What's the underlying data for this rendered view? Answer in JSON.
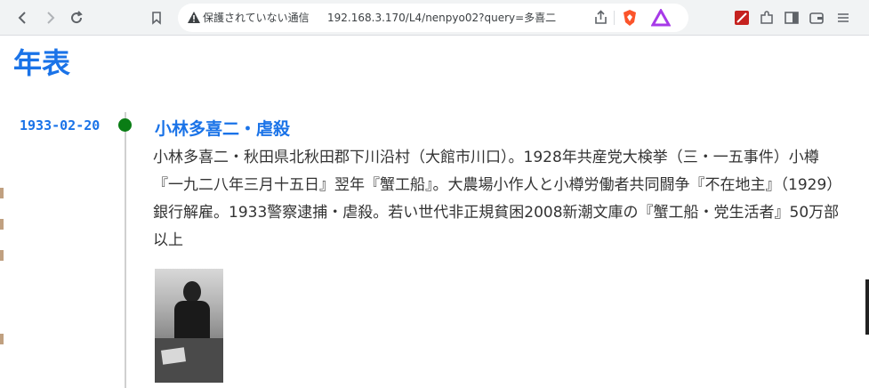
{
  "browser": {
    "security_label": "保護されていない通信",
    "url": "192.168.3.170/L4/nenpyo02?query=多喜二"
  },
  "page": {
    "title": "年表"
  },
  "event": {
    "date": "1933-02-20",
    "title": "小林多喜二・虐殺",
    "description": "小林多喜二・秋田県北秋田郡下川沿村（大館市川口）。1928年共産党大検挙（三・一五事件）小樽『一九二八年三月十五日』翌年『蟹工船』。大農場小作人と小樽労働者共同闘争『不在地主』（1929）銀行解雇。1933警察逮捕・虐殺。若い世代非正規貧困2008新潮文庫の『蟹工船・党生活者』50万部以上"
  },
  "colors": {
    "accent": "#1a73e8",
    "dot": "#0a7d15"
  }
}
